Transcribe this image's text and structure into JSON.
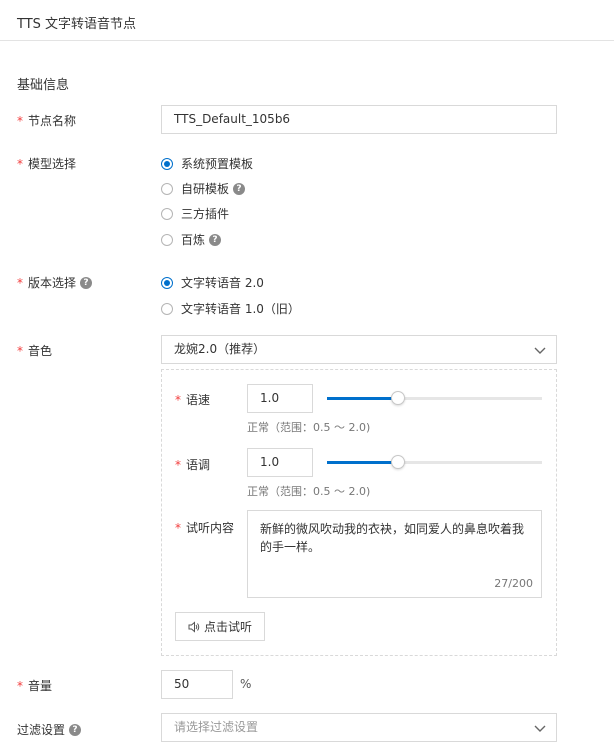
{
  "header": {
    "title": "TTS 文字转语音节点"
  },
  "section": {
    "title": "基础信息"
  },
  "node_name": {
    "label": "节点名称",
    "value": "TTS_Default_105b6"
  },
  "model": {
    "label": "模型选择",
    "options": [
      {
        "label": "系统预置模板",
        "checked": true,
        "help": false
      },
      {
        "label": "自研模板",
        "checked": false,
        "help": true
      },
      {
        "label": "三方插件",
        "checked": false,
        "help": false
      },
      {
        "label": "百炼",
        "checked": false,
        "help": true
      }
    ]
  },
  "version": {
    "label": "版本选择",
    "options": [
      {
        "label": "文字转语音 2.0",
        "checked": true
      },
      {
        "label": "文字转语音 1.0（旧）",
        "checked": false
      }
    ]
  },
  "voice": {
    "label": "音色",
    "selected": "龙婉2.0（推荐）",
    "speed": {
      "label": "语速",
      "value": "1.0",
      "hint": "正常（范围：0.5 ～ 2.0)",
      "fraction": 0.33
    },
    "pitch": {
      "label": "语调",
      "value": "1.0",
      "hint": "正常（范围：0.5 ～ 2.0)",
      "fraction": 0.33
    },
    "preview": {
      "label": "试听内容",
      "text": "新鲜的微风吹动我的衣袂，如同爱人的鼻息吹着我的手一样。",
      "counter": "27/200"
    },
    "play_button": "点击试听"
  },
  "volume": {
    "label": "音量",
    "value": "50",
    "unit": "%"
  },
  "filter": {
    "label": "过滤设置",
    "placeholder": "请选择过滤设置"
  },
  "colors": {
    "primary": "#0070cc",
    "required": "#f23c3c",
    "border": "#d9d9d9"
  },
  "icons": {
    "help": "question-circle-icon",
    "dropdown": "chevron-down-icon",
    "play": "speaker-icon"
  }
}
